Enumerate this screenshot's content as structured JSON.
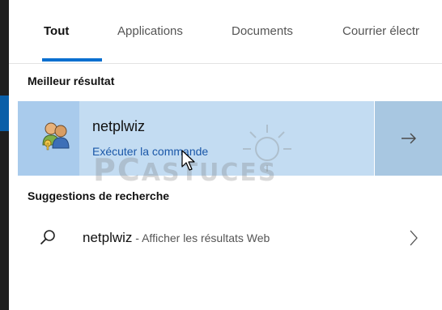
{
  "tabs": [
    {
      "label": "Tout",
      "active": true
    },
    {
      "label": "Applications",
      "active": false
    },
    {
      "label": "Documents",
      "active": false
    },
    {
      "label": "Courrier électr",
      "active": false
    }
  ],
  "best_result": {
    "heading": "Meilleur résultat",
    "title": "netplwiz",
    "subtitle": "Exécuter la commande",
    "icon": "users-icon",
    "open_icon": "arrow-right-icon"
  },
  "suggestions": {
    "heading": "Suggestions de recherche",
    "items": [
      {
        "query": "netplwiz",
        "detail": " - Afficher les résultats Web",
        "icon": "search-icon",
        "chevron": "chevron-right-icon"
      }
    ]
  },
  "watermark": {
    "main": "PC",
    "rest": "ASTUCES"
  },
  "colors": {
    "accent": "#0a6fd0",
    "selected_bg": "#c3dcf2",
    "link": "#1a57a8",
    "taskbar": "#1f1f1f"
  }
}
